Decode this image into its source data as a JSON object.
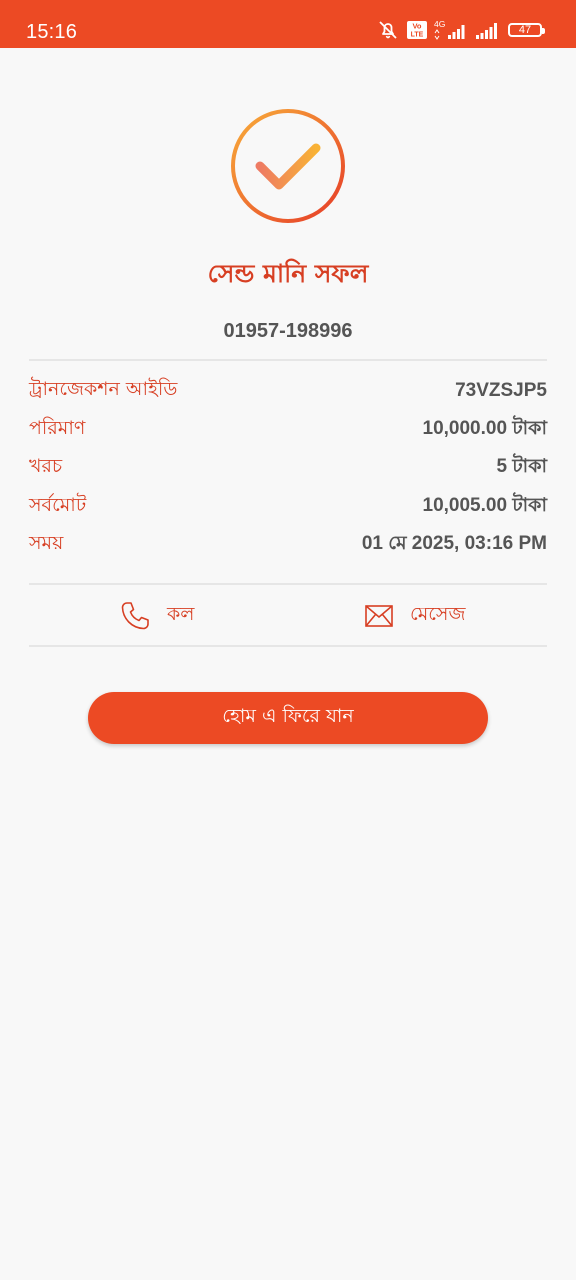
{
  "status_bar": {
    "time": "15:16",
    "lte_badge_top": "Vo",
    "lte_badge_bottom": "LTE",
    "network_type": "4G",
    "battery_level": "47",
    "background_color": "#ec4a24",
    "icons": [
      "mute-icon",
      "volte-icon",
      "signal-4g-icon",
      "signal-icon",
      "battery-icon"
    ]
  },
  "result": {
    "icon": "success-check-icon",
    "title": "সেন্ড মানি সফল",
    "phone": "01957-198996"
  },
  "details": [
    {
      "label": "ট্রানজেকশন আইডি",
      "value": "73VZSJP5"
    },
    {
      "label": "পরিমাণ",
      "value": "10,000.00 টাকা"
    },
    {
      "label": "খরচ",
      "value": "5 টাকা"
    },
    {
      "label": "সর্বমোট",
      "value": "10,005.00 টাকা"
    },
    {
      "label": "সময়",
      "value": "01 মে 2025, 03:16 PM"
    }
  ],
  "actions": {
    "call": {
      "label": "কল",
      "icon": "phone-icon"
    },
    "message": {
      "label": "মেসেজ",
      "icon": "envelope-icon"
    }
  },
  "home_button": {
    "label": "হোম এ ফিরে যান"
  },
  "colors": {
    "accent": "#ec4a24",
    "label": "#d73f23",
    "value": "#555555",
    "background": "#f8f8f8"
  }
}
